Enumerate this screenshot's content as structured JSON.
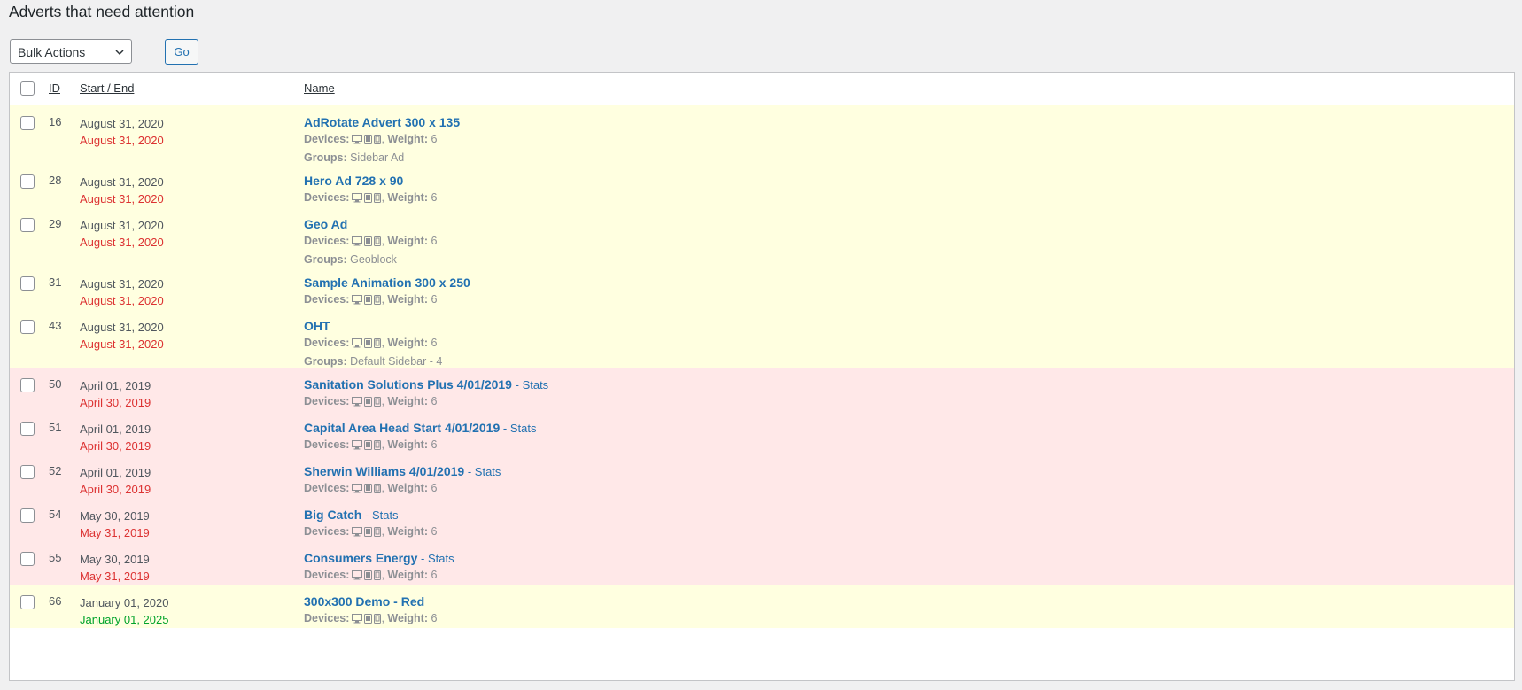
{
  "page": {
    "title": "Adverts that need attention"
  },
  "toolbar": {
    "bulk_actions": "Bulk Actions",
    "go_label": "Go"
  },
  "table": {
    "columns": {
      "id": "ID",
      "start_end": "Start / End",
      "name": "Name"
    },
    "labels": {
      "devices": "Devices:",
      "weight": "Weight:",
      "groups": "Groups:",
      "stats": "Stats",
      "dash": "-"
    },
    "icons": [
      "desktop-icon",
      "tablet-icon",
      "mobile-icon"
    ],
    "colors": {
      "warn_row": "#ffffe0",
      "expired_row": "#ffe8e8",
      "link": "#2271b1",
      "end_red": "#dc3232",
      "end_green": "#00a32a"
    },
    "rows": [
      {
        "id": "16",
        "start": "August 31, 2020",
        "end": "August 31, 2020",
        "end_status": "red",
        "status": "warn",
        "name": "AdRotate Advert 300 x 135",
        "weight": "6",
        "group": "Sidebar Ad"
      },
      {
        "id": "28",
        "start": "August 31, 2020",
        "end": "August 31, 2020",
        "end_status": "red",
        "status": "warn",
        "name": "Hero Ad 728 x 90",
        "weight": "6"
      },
      {
        "id": "29",
        "start": "August 31, 2020",
        "end": "August 31, 2020",
        "end_status": "red",
        "status": "warn",
        "name": "Geo Ad",
        "weight": "6",
        "group": "Geoblock"
      },
      {
        "id": "31",
        "start": "August 31, 2020",
        "end": "August 31, 2020",
        "end_status": "red",
        "status": "warn",
        "name": "Sample Animation 300 x 250",
        "weight": "6"
      },
      {
        "id": "43",
        "start": "August 31, 2020",
        "end": "August 31, 2020",
        "end_status": "red",
        "status": "warn",
        "name": "OHT",
        "weight": "6",
        "group": "Default Sidebar - 4"
      },
      {
        "id": "50",
        "start": "April 01, 2019",
        "end": "April 30, 2019",
        "end_status": "red",
        "status": "expired",
        "name": "Sanitation Solutions Plus 4/01/2019",
        "stats": true,
        "weight": "6"
      },
      {
        "id": "51",
        "start": "April 01, 2019",
        "end": "April 30, 2019",
        "end_status": "red",
        "status": "expired",
        "name": "Capital Area Head Start 4/01/2019",
        "stats": true,
        "weight": "6"
      },
      {
        "id": "52",
        "start": "April 01, 2019",
        "end": "April 30, 2019",
        "end_status": "red",
        "status": "expired",
        "name": "Sherwin Williams 4/01/2019",
        "stats": true,
        "weight": "6"
      },
      {
        "id": "54",
        "start": "May 30, 2019",
        "end": "May 31, 2019",
        "end_status": "red",
        "status": "expired",
        "name": "Big Catch",
        "stats": true,
        "weight": "6"
      },
      {
        "id": "55",
        "start": "May 30, 2019",
        "end": "May 31, 2019",
        "end_status": "red",
        "status": "expired",
        "name": "Consumers Energy",
        "stats": true,
        "weight": "6"
      },
      {
        "id": "66",
        "start": "January 01, 2020",
        "end": "January 01, 2025",
        "end_status": "green",
        "status": "warn",
        "name": "300x300 Demo - Red",
        "weight": "6"
      }
    ]
  }
}
